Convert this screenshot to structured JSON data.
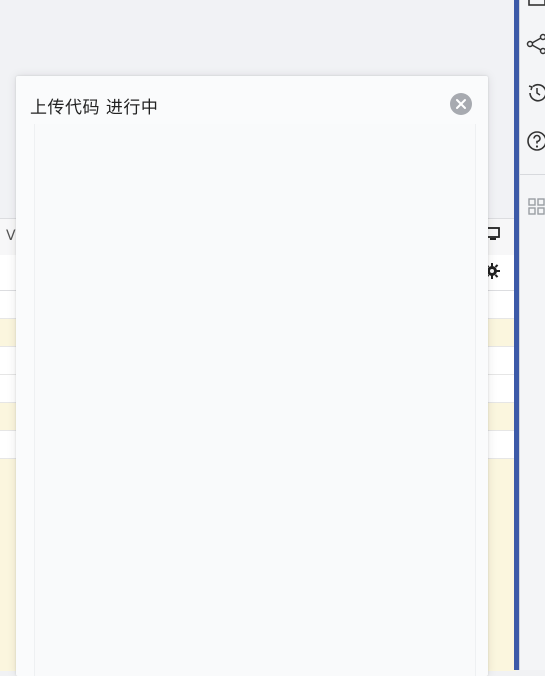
{
  "dialog": {
    "title": "上传代码 进行中",
    "close_icon": "close-circle-icon"
  },
  "background": {
    "tab_fragment": "V",
    "rows": [
      {
        "highlighted": false
      },
      {
        "highlighted": true
      },
      {
        "highlighted": false
      },
      {
        "highlighted": false
      },
      {
        "highlighted": true
      },
      {
        "highlighted": false
      },
      {
        "highlighted": true
      }
    ],
    "table_icons": [
      "monitor-icon",
      "gear-icon"
    ]
  },
  "right_toolbar": {
    "icons": [
      "panel-icon",
      "share-icon",
      "history-icon",
      "help-icon",
      "grid-icon"
    ]
  },
  "colors": {
    "accent_divider": "#3c5aa8",
    "highlight_row": "#fbf6de",
    "modal_bg": "#fafbfc",
    "close_button": "#a7aab0"
  }
}
